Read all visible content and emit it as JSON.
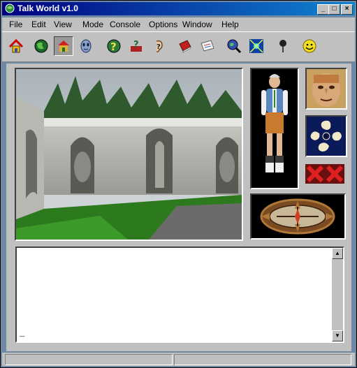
{
  "window": {
    "title": "Talk World v1.0",
    "minimize": "_",
    "maximize": "□",
    "close": "×"
  },
  "menu": [
    "File",
    "Edit",
    "View",
    "Mode",
    "Console",
    "Options",
    "Window",
    "Help"
  ],
  "toolbar": {
    "icons": [
      "home-icon",
      "globe-icon",
      "house-icon",
      "mask-icon",
      "question-globe-icon",
      "question-book-icon",
      "ear-question-icon",
      "book-icon",
      "mail-icon",
      "search-globe-icon",
      "network-icon",
      "microphone-icon",
      "smiley-icon"
    ]
  },
  "chat": {
    "text": "_"
  },
  "scroll": {
    "up": "▲",
    "down": "▼"
  }
}
